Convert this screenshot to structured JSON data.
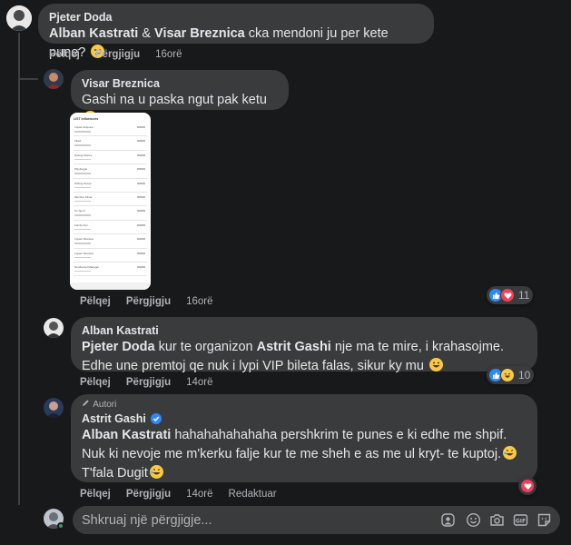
{
  "comments": [
    {
      "author": "Pjeter Doda",
      "mention1": "Alban Kastrati",
      "amp": " & ",
      "mention2": "Visar Breznica",
      "text": " cka mendoni ju per kete pune?",
      "emoji": "thinking-face",
      "actions": {
        "like": "Pëlqej",
        "reply": "Përgjigju",
        "time": "16orë"
      }
    },
    {
      "author": "Visar Breznica",
      "text": "Gashi na u paska ngut pak ketu",
      "emoji": "smiling-face",
      "actions": {
        "like": "Pëlqej",
        "reply": "Përgjigju",
        "time": "16orë"
      },
      "reactions": {
        "types": [
          "like",
          "love"
        ],
        "count": "11"
      },
      "screenshot": {
        "title": "LIST influencers",
        "rows": [
          "Impact Enquirer",
          "Inkett",
          "Writing Stories",
          "Playbuggs",
          "Writing Stores",
          "Member Klinet",
          "Su Sport",
          "Family Fun",
          "Impact Reviews",
          "Impact Reviews",
          "Nerdvorsel Manager"
        ]
      }
    },
    {
      "author": "Alban Kastrati",
      "mention1": "Pjeter Doda",
      "text_a": " kur te organizon ",
      "mention2": "Astrit Gashi",
      "text_b": " nje ma te mire, i krahasojme. Edhe une premtoj qe nuk i lypi VIP bileta falas, sikur ky mu",
      "emoji": "grinning-face",
      "actions": {
        "like": "Pëlqej",
        "reply": "Përgjigju",
        "time": "14orë"
      },
      "reactions": {
        "types": [
          "like",
          "haha"
        ],
        "count": "10"
      }
    },
    {
      "badge": "Autori",
      "author": "Astrit Gashi",
      "mention1": "Alban Kastrati",
      "text_a": " hahahahahahaha pershkrim te punes e ki edhe me shpif. Nuk ki nevoje me m'kerku falje kur te me sheh e as me ul kryt- te kuptoj.",
      "text_b": " T'fala Dugit",
      "actions": {
        "like": "Pëlqej",
        "reply": "Përgjigju",
        "time": "14orë",
        "edited": "Redaktuar"
      },
      "reactions": {
        "types": [
          "love"
        ],
        "count": ""
      }
    }
  ],
  "composer": {
    "placeholder": "Shkruaj një përgjigje..."
  },
  "colors": {
    "bg": "#18191a",
    "bubble": "#3a3b3c",
    "like": "#2d88ff",
    "love": "#f33e58",
    "haha": "#f7c948"
  }
}
